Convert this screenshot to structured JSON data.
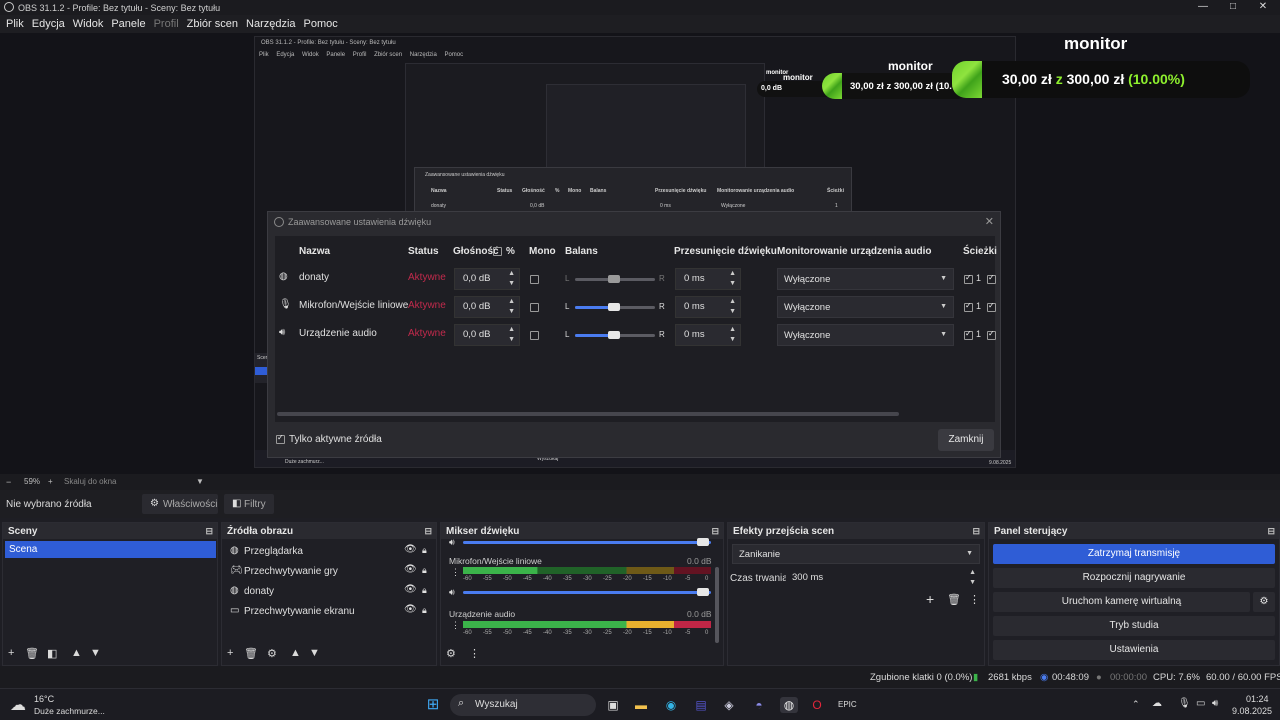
{
  "window": {
    "title": "OBS 31.1.2 - Profile: Bez tytułu - Sceny: Bez tytułu",
    "minimize": "—",
    "maximize": "□",
    "close": "✕"
  },
  "menu": [
    "Plik",
    "Edycja",
    "Widok",
    "Panele",
    "Profil",
    "Zbiór scen",
    "Narzędzia",
    "Pomoc"
  ],
  "nested_preview": {
    "title": "OBS 31.1.2 - Profile: Bez tytułu - Sceny: Bez tytułu",
    "menu": [
      "Plik",
      "Edycja",
      "Widok",
      "Panele",
      "Profil",
      "Zbiór scen",
      "Narzędzia",
      "Pomoc"
    ],
    "nested_dialog_title": "Zaawansowane ustawienia dźwięku",
    "nested_headers": [
      "Nazwa",
      "Status",
      "Głośność",
      "%",
      "Mono",
      "Balans",
      "Przesunięcie dźwięku",
      "Monitorowanie urządzenia audio",
      "Ścieżki"
    ],
    "nested_row": {
      "name": "donaty",
      "volume": "0,0 dB",
      "offset": "0 ms",
      "monitor": "Wyłączone",
      "tracks": "1"
    },
    "taskbar_weather": "Duże zachmurz...",
    "taskbar_search": "Wyszukaj",
    "taskbar_date": "9.08.2025",
    "scene_label": "Scen"
  },
  "overlay": {
    "title": "monitor",
    "amount_text": "30,00 zł",
    "mid": "z",
    "goal_text": "300,00 zł",
    "percent_text": "(10.00%)",
    "progress": 0.1,
    "small_title": "monitor",
    "small_amount": "30,00 zł z 300,00 zł (10.00"
  },
  "audio_dialog": {
    "title": "Zaawansowane ustawienia dźwięku",
    "close": "✕",
    "headers": {
      "name": "Nazwa",
      "status": "Status",
      "volume": "Głośność",
      "percent": "%",
      "mono": "Mono",
      "balance": "Balans",
      "offset": "Przesunięcie dźwięku",
      "monitoring": "Monitorowanie urządzenia audio",
      "tracks": "Ścieżki"
    },
    "rows": [
      {
        "name": "donaty",
        "status": "Aktywne",
        "volume": "0,0 dB",
        "bal_l": "L",
        "bal_r": "R",
        "offset": "0 ms",
        "monitor": "Wyłączone",
        "track": "1",
        "icon": "globe-icon",
        "balance": 0.5,
        "enabled_balance": false
      },
      {
        "name": "Mikrofon/Wejście liniowe",
        "status": "Aktywne",
        "volume": "0,0 dB",
        "bal_l": "L",
        "bal_r": "R",
        "offset": "0 ms",
        "monitor": "Wyłączone",
        "track": "1",
        "icon": "microphone-icon",
        "balance": 0.5,
        "enabled_balance": true
      },
      {
        "name": "Urządzenie audio",
        "status": "Aktywne",
        "volume": "0,0 dB",
        "bal_l": "L",
        "bal_r": "R",
        "offset": "0 ms",
        "monitor": "Wyłączone",
        "track": "1",
        "icon": "speaker-icon",
        "balance": 0.5,
        "enabled_balance": true
      }
    ],
    "only_active": "Tylko aktywne źródła",
    "close_button": "Zamknij"
  },
  "zoom": {
    "value": "59%",
    "fit": "Skaluj do okna"
  },
  "source_bar": {
    "no_source": "Nie wybrano źródła",
    "properties": "Właściwości",
    "filters": "Filtry"
  },
  "docks": {
    "scenes": {
      "title": "Sceny",
      "items": [
        "Scena"
      ]
    },
    "sources": {
      "title": "Źródła obrazu",
      "items": [
        {
          "label": "Przeglądarka",
          "icon": "globe-icon"
        },
        {
          "label": "Przechwytywanie gry",
          "icon": "gamepad-icon"
        },
        {
          "label": "donaty",
          "icon": "globe-icon"
        },
        {
          "label": "Przechwytywanie ekranu",
          "icon": "monitor-icon"
        }
      ]
    },
    "mixer": {
      "title": "Mikser dźwięku",
      "channels": [
        {
          "name": "Mikrofon/Wejście liniowe",
          "db": "0.0 dB"
        },
        {
          "name": "Urządzenie audio",
          "db": "0.0 dB"
        }
      ],
      "scale": [
        "-60",
        "-55",
        "-50",
        "-45",
        "-40",
        "-35",
        "-30",
        "-25",
        "-20",
        "-15",
        "-10",
        "-5",
        "0"
      ]
    },
    "transitions": {
      "title": "Efekty przejścia scen",
      "selected": "Zanikanie",
      "duration_label": "Czas trwania",
      "duration_value": "300 ms"
    },
    "controls": {
      "title": "Panel sterujący",
      "buttons": [
        "Zatrzymaj transmisję",
        "Rozpocznij nagrywanie",
        "Uruchom kamerę wirtualną",
        "Tryb studia",
        "Ustawienia"
      ]
    }
  },
  "status": {
    "dropped": "Zgubione klatki 0 (0.0%)",
    "bitrate": "2681 kbps",
    "stream_time": "00:48:09",
    "rec_time": "00:00:00",
    "cpu": "CPU: 7.6%",
    "fps": "60.00 / 60.00 FPS"
  },
  "taskbar": {
    "temp": "16°C",
    "weather": "Duże zachmurze...",
    "search": "Wyszukaj",
    "time": "01:24",
    "date": "9.08.2025"
  },
  "colors": {
    "accent": "#2f5dd6",
    "status_red": "#c22a4c",
    "progress_green": "#7cd834"
  }
}
